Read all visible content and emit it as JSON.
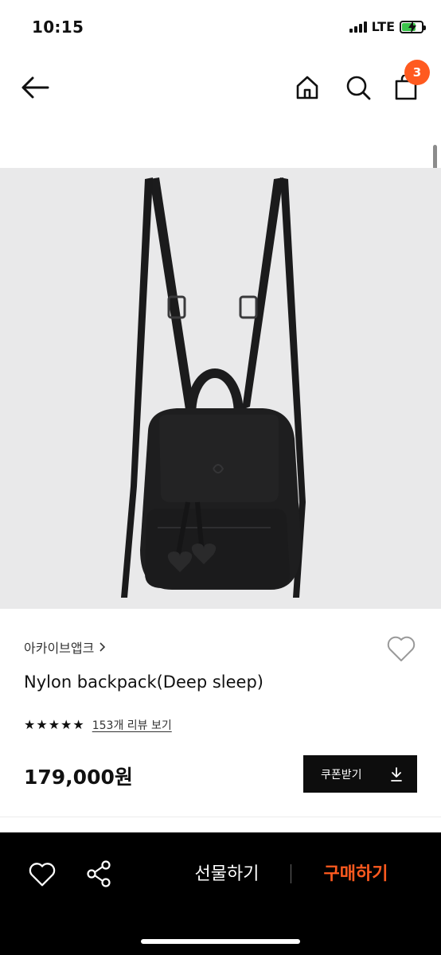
{
  "status_bar": {
    "time": "10:15",
    "network": "LTE",
    "battery_fraction": 0.7
  },
  "nav": {
    "cart_count": "3",
    "icons": [
      "back-arrow-icon",
      "home-icon",
      "search-icon",
      "shopping-bag-icon"
    ]
  },
  "product": {
    "brand": "아카이브앱크",
    "name": "Nylon backpack(Deep sleep)",
    "rating_stars": 5,
    "review_link": "153개 리뷰 보기",
    "price": "179,000원",
    "coupon_label": "쿠폰받기"
  },
  "bottom_bar": {
    "gift_label": "선물하기",
    "buy_label": "구매하기"
  },
  "colors": {
    "accent": "#ff5a1f",
    "image_bg": "#e9e9ea",
    "button_dark": "#0d0d0d"
  }
}
